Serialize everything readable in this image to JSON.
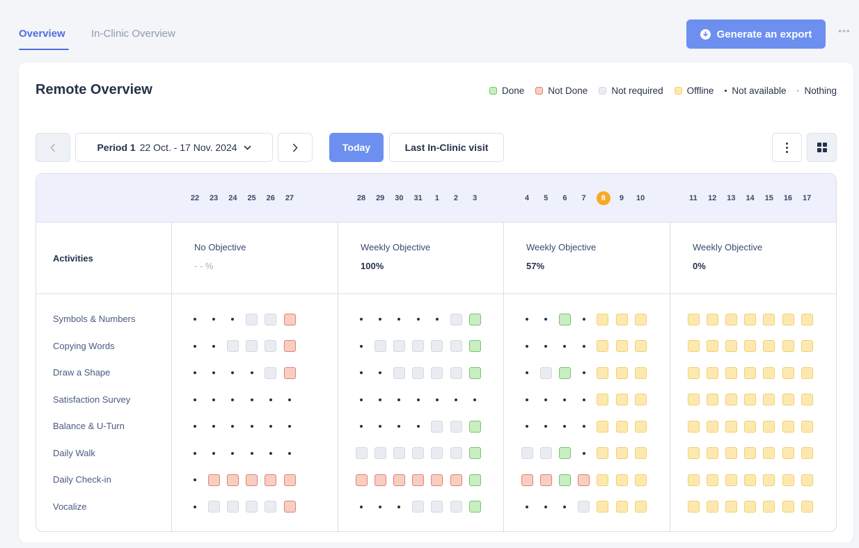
{
  "tabs": [
    {
      "label": "Overview",
      "active": true
    },
    {
      "label": "In-Clinic Overview",
      "active": false
    }
  ],
  "export": {
    "label": "Generate an export",
    "icon": "download-circle-icon"
  },
  "card": {
    "title": "Remote Overview"
  },
  "legend": [
    {
      "label": "Done",
      "type": "square",
      "status": "done"
    },
    {
      "label": "Not Done",
      "type": "square",
      "status": "notdone"
    },
    {
      "label": "Not required",
      "type": "square",
      "status": "notreq"
    },
    {
      "label": "Offline",
      "type": "square",
      "status": "offline"
    },
    {
      "label": "Not available",
      "type": "dot",
      "status": "na"
    },
    {
      "label": "Nothing",
      "type": "dot-light",
      "status": "nothing"
    }
  ],
  "period": {
    "name": "Period 1",
    "range": "22 Oct. - 17 Nov. 2024"
  },
  "buttons": {
    "today": "Today",
    "last_visit": "Last In-Clinic visit"
  },
  "colors": {
    "accent": "#6c8ff0",
    "done": "#c9eec2",
    "notdone": "#f8cdc2",
    "notreq": "#e9ecf1",
    "offline": "#fde9b0",
    "today": "#f7a928"
  },
  "table": {
    "activities_header": "Activities",
    "today_day": "8",
    "weeks": [
      {
        "days": [
          "22",
          "23",
          "24",
          "25",
          "26",
          "27"
        ],
        "objective": "No Objective",
        "value": "- - %"
      },
      {
        "days": [
          "28",
          "29",
          "30",
          "31",
          "1",
          "2",
          "3"
        ],
        "objective": "Weekly Objective",
        "value": "100%"
      },
      {
        "days": [
          "4",
          "5",
          "6",
          "7",
          "8",
          "9",
          "10"
        ],
        "objective": "Weekly Objective",
        "value": "57%"
      },
      {
        "days": [
          "11",
          "12",
          "13",
          "14",
          "15",
          "16",
          "17"
        ],
        "objective": "Weekly Objective",
        "value": "0%"
      }
    ],
    "activities": [
      {
        "label": "Symbols & Numbers",
        "weeks": [
          [
            "na",
            "na",
            "na",
            "notreq",
            "notreq",
            "notdone"
          ],
          [
            "na",
            "na",
            "na",
            "na",
            "na",
            "notreq",
            "done"
          ],
          [
            "na",
            "na",
            "done",
            "na",
            "offline",
            "offline",
            "offline"
          ],
          [
            "offline",
            "offline",
            "offline",
            "offline",
            "offline",
            "offline",
            "offline"
          ]
        ]
      },
      {
        "label": "Copying Words",
        "weeks": [
          [
            "na",
            "na",
            "notreq",
            "notreq",
            "notreq",
            "notdone"
          ],
          [
            "na",
            "notreq",
            "notreq",
            "notreq",
            "notreq",
            "notreq",
            "done"
          ],
          [
            "na",
            "na",
            "na",
            "na",
            "offline",
            "offline",
            "offline"
          ],
          [
            "offline",
            "offline",
            "offline",
            "offline",
            "offline",
            "offline",
            "offline"
          ]
        ]
      },
      {
        "label": "Draw a Shape",
        "weeks": [
          [
            "na",
            "na",
            "na",
            "na",
            "notreq",
            "notdone"
          ],
          [
            "na",
            "na",
            "notreq",
            "notreq",
            "notreq",
            "notreq",
            "done"
          ],
          [
            "na",
            "notreq",
            "done",
            "na",
            "offline",
            "offline",
            "offline"
          ],
          [
            "offline",
            "offline",
            "offline",
            "offline",
            "offline",
            "offline",
            "offline"
          ]
        ]
      },
      {
        "label": "Satisfaction Survey",
        "weeks": [
          [
            "na",
            "na",
            "na",
            "na",
            "na",
            "na"
          ],
          [
            "na",
            "na",
            "na",
            "na",
            "na",
            "na",
            "na"
          ],
          [
            "na",
            "na",
            "na",
            "na",
            "offline",
            "offline",
            "offline"
          ],
          [
            "offline",
            "offline",
            "offline",
            "offline",
            "offline",
            "offline",
            "offline"
          ]
        ]
      },
      {
        "label": "Balance & U-Turn",
        "weeks": [
          [
            "na",
            "na",
            "na",
            "na",
            "na",
            "na"
          ],
          [
            "na",
            "na",
            "na",
            "na",
            "notreq",
            "notreq",
            "done"
          ],
          [
            "na",
            "na",
            "na",
            "na",
            "offline",
            "offline",
            "offline"
          ],
          [
            "offline",
            "offline",
            "offline",
            "offline",
            "offline",
            "offline",
            "offline"
          ]
        ]
      },
      {
        "label": "Daily Walk",
        "weeks": [
          [
            "na",
            "na",
            "na",
            "na",
            "na",
            "na"
          ],
          [
            "notreq",
            "notreq",
            "notreq",
            "notreq",
            "notreq",
            "notreq",
            "done"
          ],
          [
            "notreq",
            "notreq",
            "done",
            "na",
            "offline",
            "offline",
            "offline"
          ],
          [
            "offline",
            "offline",
            "offline",
            "offline",
            "offline",
            "offline",
            "offline"
          ]
        ]
      },
      {
        "label": "Daily Check-in",
        "weeks": [
          [
            "na",
            "notdone",
            "notdone",
            "notdone",
            "notdone",
            "notdone"
          ],
          [
            "notdone",
            "notdone",
            "notdone",
            "notdone",
            "notdone",
            "notdone",
            "done"
          ],
          [
            "notdone",
            "notdone",
            "done",
            "notdone",
            "offline",
            "offline",
            "offline"
          ],
          [
            "offline",
            "offline",
            "offline",
            "offline",
            "offline",
            "offline",
            "offline"
          ]
        ]
      },
      {
        "label": "Vocalize",
        "weeks": [
          [
            "na",
            "notreq",
            "notreq",
            "notreq",
            "notreq",
            "notdone"
          ],
          [
            "na",
            "na",
            "na",
            "notreq",
            "notreq",
            "notreq",
            "done"
          ],
          [
            "na",
            "na",
            "na",
            "notreq",
            "offline",
            "offline",
            "offline"
          ],
          [
            "offline",
            "offline",
            "offline",
            "offline",
            "offline",
            "offline",
            "offline"
          ]
        ]
      }
    ]
  }
}
